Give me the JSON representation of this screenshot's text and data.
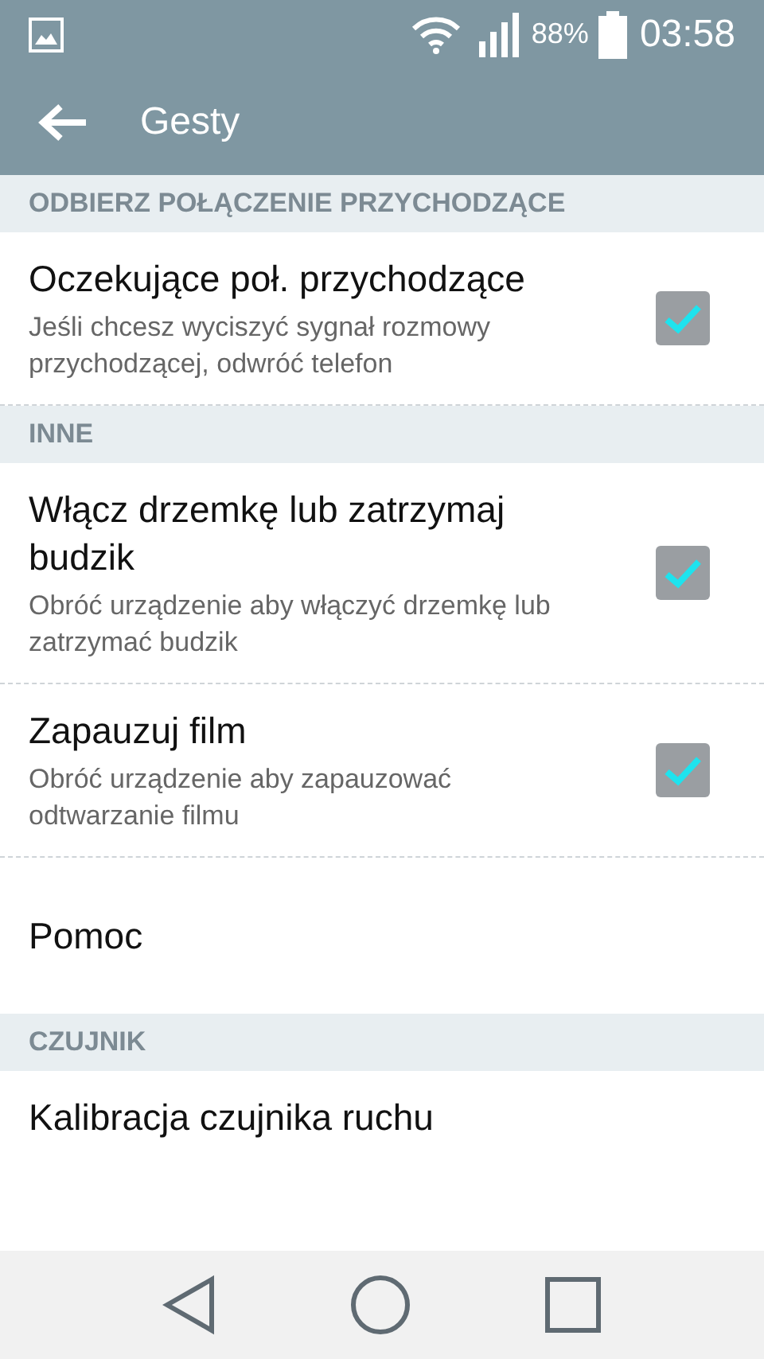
{
  "status_bar": {
    "battery": "88%",
    "time": "03:58"
  },
  "app_bar": {
    "title": "Gesty"
  },
  "items": [
    {
      "kind": "section",
      "title": "ODBIERZ POŁĄCZENIE PRZYCHODZĄCE"
    },
    {
      "kind": "toggle",
      "title": "Oczekujące poł. przychodzące",
      "subtitle": "Jeśli chcesz wyciszyć sygnał rozmowy przychodzącej, odwróć telefon",
      "checked": true
    },
    {
      "kind": "section",
      "title": "INNE"
    },
    {
      "kind": "toggle",
      "title": "Włącz drzemkę lub zatrzymaj budzik",
      "subtitle": "Obróć urządzenie aby włączyć drzemkę lub zatrzymać budzik",
      "checked": true
    },
    {
      "kind": "toggle",
      "title": "Zapauzuj film",
      "subtitle": "Obróć urządzenie aby zapauzować odtwarzanie filmu",
      "checked": true
    },
    {
      "kind": "plain",
      "title": "Pomoc"
    },
    {
      "kind": "section",
      "title": "CZUJNIK"
    },
    {
      "kind": "plain",
      "title": "Kalibracja czujnika ruchu"
    }
  ]
}
